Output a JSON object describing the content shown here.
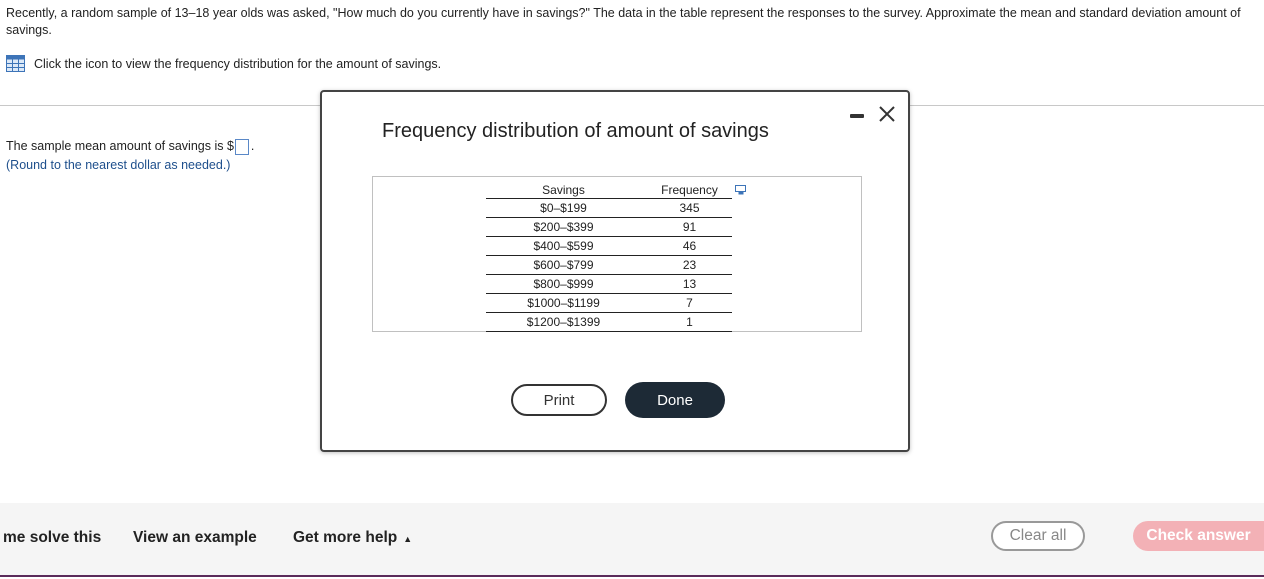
{
  "question": {
    "text": "Recently, a random sample of 13–18 year olds was asked, \"How much do you currently have in savings?\" The data in the table represent the responses to the survey. Approximate the mean and standard deviation amount of savings."
  },
  "icon_link": {
    "label": "Click the icon to view the frequency distribution for the amount of savings.",
    "icon": "table-icon"
  },
  "answer": {
    "prefix": "The sample mean amount of savings is $",
    "suffix": ".",
    "hint": "(Round to the nearest dollar as needed.)"
  },
  "modal": {
    "title": "Frequency distribution of amount of savings",
    "minimize_icon": "minimize-icon",
    "close_icon": "close-icon",
    "table": {
      "headers": [
        "Savings",
        "Frequency"
      ],
      "rows": [
        [
          "$0–$199",
          "345"
        ],
        [
          "$200–$399",
          "91"
        ],
        [
          "$400–$599",
          "46"
        ],
        [
          "$600–$799",
          "23"
        ],
        [
          "$800–$999",
          "13"
        ],
        [
          "$1000–$1199",
          "7"
        ],
        [
          "$1200–$1399",
          "1"
        ]
      ]
    },
    "print_label": "Print",
    "done_label": "Done"
  },
  "footer": {
    "help_solve": "me solve this",
    "view_example": "View an example",
    "more_help": "Get more help",
    "clear_all": "Clear all",
    "check_answer": "Check answer"
  },
  "colors": {
    "accent_dark": "#1d2a36",
    "check_answer_bg": "#f3b1b6",
    "hint": "#1e4f8c",
    "footer_line": "#5a2a5a"
  }
}
